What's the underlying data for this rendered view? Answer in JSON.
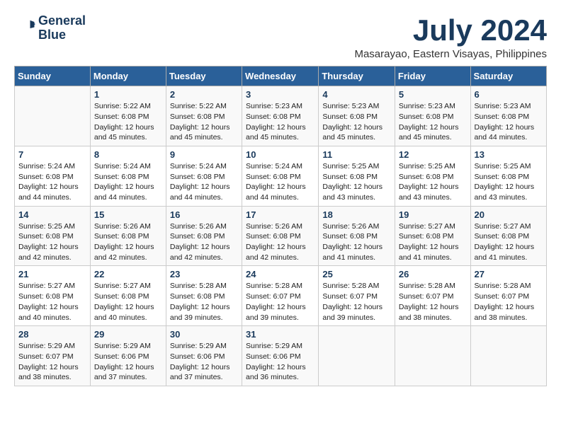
{
  "logo": {
    "line1": "General",
    "line2": "Blue"
  },
  "title": "July 2024",
  "location": "Masarayao, Eastern Visayas, Philippines",
  "headers": [
    "Sunday",
    "Monday",
    "Tuesday",
    "Wednesday",
    "Thursday",
    "Friday",
    "Saturday"
  ],
  "weeks": [
    [
      {
        "day": "",
        "info": ""
      },
      {
        "day": "1",
        "info": "Sunrise: 5:22 AM\nSunset: 6:08 PM\nDaylight: 12 hours\nand 45 minutes."
      },
      {
        "day": "2",
        "info": "Sunrise: 5:22 AM\nSunset: 6:08 PM\nDaylight: 12 hours\nand 45 minutes."
      },
      {
        "day": "3",
        "info": "Sunrise: 5:23 AM\nSunset: 6:08 PM\nDaylight: 12 hours\nand 45 minutes."
      },
      {
        "day": "4",
        "info": "Sunrise: 5:23 AM\nSunset: 6:08 PM\nDaylight: 12 hours\nand 45 minutes."
      },
      {
        "day": "5",
        "info": "Sunrise: 5:23 AM\nSunset: 6:08 PM\nDaylight: 12 hours\nand 45 minutes."
      },
      {
        "day": "6",
        "info": "Sunrise: 5:23 AM\nSunset: 6:08 PM\nDaylight: 12 hours\nand 44 minutes."
      }
    ],
    [
      {
        "day": "7",
        "info": "Sunrise: 5:24 AM\nSunset: 6:08 PM\nDaylight: 12 hours\nand 44 minutes."
      },
      {
        "day": "8",
        "info": "Sunrise: 5:24 AM\nSunset: 6:08 PM\nDaylight: 12 hours\nand 44 minutes."
      },
      {
        "day": "9",
        "info": "Sunrise: 5:24 AM\nSunset: 6:08 PM\nDaylight: 12 hours\nand 44 minutes."
      },
      {
        "day": "10",
        "info": "Sunrise: 5:24 AM\nSunset: 6:08 PM\nDaylight: 12 hours\nand 44 minutes."
      },
      {
        "day": "11",
        "info": "Sunrise: 5:25 AM\nSunset: 6:08 PM\nDaylight: 12 hours\nand 43 minutes."
      },
      {
        "day": "12",
        "info": "Sunrise: 5:25 AM\nSunset: 6:08 PM\nDaylight: 12 hours\nand 43 minutes."
      },
      {
        "day": "13",
        "info": "Sunrise: 5:25 AM\nSunset: 6:08 PM\nDaylight: 12 hours\nand 43 minutes."
      }
    ],
    [
      {
        "day": "14",
        "info": "Sunrise: 5:25 AM\nSunset: 6:08 PM\nDaylight: 12 hours\nand 42 minutes."
      },
      {
        "day": "15",
        "info": "Sunrise: 5:26 AM\nSunset: 6:08 PM\nDaylight: 12 hours\nand 42 minutes."
      },
      {
        "day": "16",
        "info": "Sunrise: 5:26 AM\nSunset: 6:08 PM\nDaylight: 12 hours\nand 42 minutes."
      },
      {
        "day": "17",
        "info": "Sunrise: 5:26 AM\nSunset: 6:08 PM\nDaylight: 12 hours\nand 42 minutes."
      },
      {
        "day": "18",
        "info": "Sunrise: 5:26 AM\nSunset: 6:08 PM\nDaylight: 12 hours\nand 41 minutes."
      },
      {
        "day": "19",
        "info": "Sunrise: 5:27 AM\nSunset: 6:08 PM\nDaylight: 12 hours\nand 41 minutes."
      },
      {
        "day": "20",
        "info": "Sunrise: 5:27 AM\nSunset: 6:08 PM\nDaylight: 12 hours\nand 41 minutes."
      }
    ],
    [
      {
        "day": "21",
        "info": "Sunrise: 5:27 AM\nSunset: 6:08 PM\nDaylight: 12 hours\nand 40 minutes."
      },
      {
        "day": "22",
        "info": "Sunrise: 5:27 AM\nSunset: 6:08 PM\nDaylight: 12 hours\nand 40 minutes."
      },
      {
        "day": "23",
        "info": "Sunrise: 5:28 AM\nSunset: 6:08 PM\nDaylight: 12 hours\nand 39 minutes."
      },
      {
        "day": "24",
        "info": "Sunrise: 5:28 AM\nSunset: 6:07 PM\nDaylight: 12 hours\nand 39 minutes."
      },
      {
        "day": "25",
        "info": "Sunrise: 5:28 AM\nSunset: 6:07 PM\nDaylight: 12 hours\nand 39 minutes."
      },
      {
        "day": "26",
        "info": "Sunrise: 5:28 AM\nSunset: 6:07 PM\nDaylight: 12 hours\nand 38 minutes."
      },
      {
        "day": "27",
        "info": "Sunrise: 5:28 AM\nSunset: 6:07 PM\nDaylight: 12 hours\nand 38 minutes."
      }
    ],
    [
      {
        "day": "28",
        "info": "Sunrise: 5:29 AM\nSunset: 6:07 PM\nDaylight: 12 hours\nand 38 minutes."
      },
      {
        "day": "29",
        "info": "Sunrise: 5:29 AM\nSunset: 6:06 PM\nDaylight: 12 hours\nand 37 minutes."
      },
      {
        "day": "30",
        "info": "Sunrise: 5:29 AM\nSunset: 6:06 PM\nDaylight: 12 hours\nand 37 minutes."
      },
      {
        "day": "31",
        "info": "Sunrise: 5:29 AM\nSunset: 6:06 PM\nDaylight: 12 hours\nand 36 minutes."
      },
      {
        "day": "",
        "info": ""
      },
      {
        "day": "",
        "info": ""
      },
      {
        "day": "",
        "info": ""
      }
    ]
  ]
}
